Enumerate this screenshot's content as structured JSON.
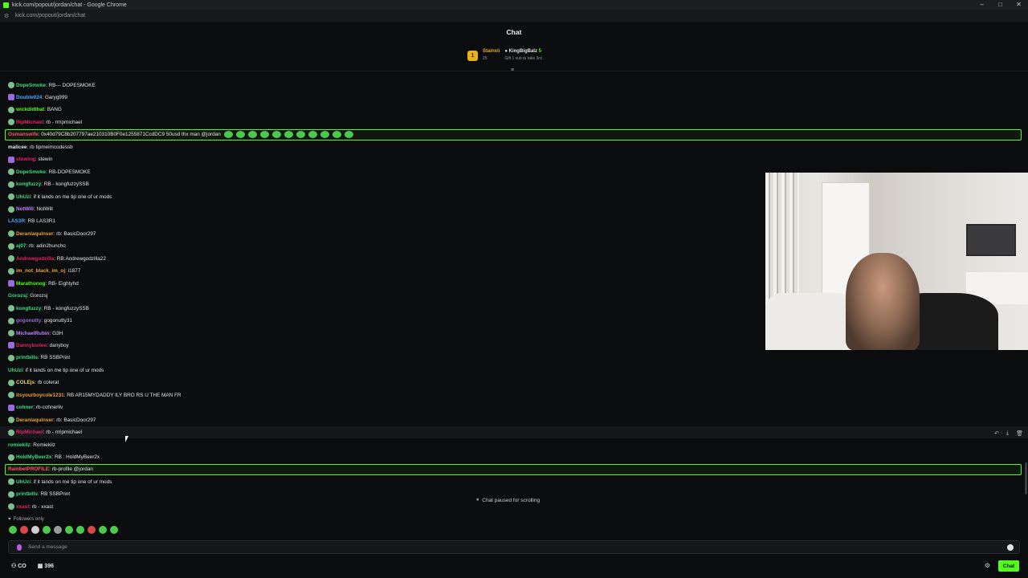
{
  "window": {
    "title": "kick.com/popout/jordan/chat - Google Chrome",
    "url": "kick.com/popout/jordan/chat",
    "controls": [
      "–",
      "□",
      "✕"
    ]
  },
  "header": {
    "title": "Chat"
  },
  "leaderboard": {
    "first": {
      "rank": "1",
      "name": "Stainxii",
      "count": "25"
    },
    "second": {
      "name": "KingBigBalz",
      "count": "5",
      "note": "Gift 1 sub to take 3rd"
    }
  },
  "messages": [
    {
      "user": "DopeSmoke",
      "color": "#3ddc84",
      "text": ": RB--- DOPESMOKE"
    },
    {
      "user": "Double024",
      "color": "#4aa8ff",
      "text": ": Garyg999"
    },
    {
      "user": "wickdidthat",
      "color": "#53fc18",
      "text": ": BANG"
    },
    {
      "user": "RipMichael",
      "color": "#e0245e",
      "text": ": rb - rrripmichael"
    },
    {
      "user": "Osmanswife",
      "color": "#ff4f6d",
      "text": ": 0x40d79C8b207797ae210310B0F0e1255871CcdDC9 50usd thx man @jordan",
      "highlight": true
    },
    {
      "user": "malicee",
      "color": "#e6e6e6",
      "text": ": rb tipmeimcodessb"
    },
    {
      "user": "stewing",
      "color": "#e0245e",
      "text": ": stewin"
    },
    {
      "user": "DopeSmoke",
      "color": "#3ddc84",
      "text": ": RB-DOPESMOKE"
    },
    {
      "user": "kongfuzzy",
      "color": "#3ddc84",
      "text": ": RB - kongfuzzySSB"
    },
    {
      "user": "UhUzi",
      "color": "#3ddc84",
      "text": ": if it lands on me tip one of ur mods"
    },
    {
      "user": "NotWill",
      "color": "#c080ff",
      "text": ": NotWill"
    },
    {
      "user": "LAS3R",
      "color": "#4aa8ff",
      "text": ": RB LAS3R1"
    },
    {
      "user": "Deranlaquinser",
      "color": "#e9a23b",
      "text": ": rb: BasicDoor297"
    },
    {
      "user": "aj07",
      "color": "#3ddc84",
      "text": ": rb: adin2huncho"
    },
    {
      "user": "Andrewgodzilla",
      "color": "#e0245e",
      "text": ": RB:Andrewgodzilla22"
    },
    {
      "user": "im_not_black_im_oj",
      "color": "#e9a23b",
      "text": ": i1877"
    },
    {
      "user": "Marathonog",
      "color": "#53fc18",
      "text": ": RB- Eightyhd"
    },
    {
      "user": "Gorozsj",
      "color": "#3ddc84",
      "text": ": Gorozsj"
    },
    {
      "user": "kongfuzzy",
      "color": "#3ddc84",
      "text": ": RB - kongfuzzySSB"
    },
    {
      "user": "gogonutty",
      "color": "#9a6ad8",
      "text": ": gogonutty31"
    },
    {
      "user": "MichaelRubin",
      "color": "#c080ff",
      "text": ": G3H"
    },
    {
      "user": "Dannyboiiee",
      "color": "#e0245e",
      "text": ": danyboy"
    },
    {
      "user": "printbills",
      "color": "#3ddc84",
      "text": ": RB SSBPrint"
    },
    {
      "user": "UhUzi",
      "color": "#3ddc84",
      "text": ": if it lands on me tip one of ur mods"
    },
    {
      "user": "COLEjs",
      "color": "#f0d36a",
      "text": ": rb colerat"
    },
    {
      "user": "itsyourboycole1231",
      "color": "#e9a23b",
      "text": ": RB AR15MYDADDY ILY BRO RS U THE MAN FR"
    },
    {
      "user": "cohner",
      "color": "#3ddc84",
      "text": ": rb-cohnerliv"
    },
    {
      "user": "Deranlaquinser",
      "color": "#e9a23b",
      "text": ": rb: BasicDoor297"
    },
    {
      "user": "RipMichael",
      "color": "#e0245e",
      "text": ": rb - rrripmichael",
      "hovered": true
    },
    {
      "user": "romiekilz",
      "color": "#3ddc84",
      "text": ": Romiekilz"
    },
    {
      "user": "HoldMyBeer2x",
      "color": "#3ddc84",
      "text": ": RB : HoldMyBeer2x"
    },
    {
      "user": "RainbetPROFILE",
      "color": "#ff4f6d",
      "text": ": rb-profile @jordan",
      "highlight": true
    },
    {
      "user": "UhUzi",
      "color": "#3ddc84",
      "text": ": if it lands on me tip one of ur mods"
    },
    {
      "user": "printbills",
      "color": "#3ddc84",
      "text": ": RB SSBPrint"
    },
    {
      "user": "xxast",
      "color": "#e0245e",
      "text": ": rb - xxast"
    }
  ],
  "chat_status": {
    "paused": "Chat paused for scrolling",
    "mode": "Followers only"
  },
  "input": {
    "placeholder": "Send a message"
  },
  "footer": {
    "points": "CO",
    "viewers": "396",
    "chat_button": "Chat"
  },
  "colors": {
    "accent": "#53fc18",
    "background": "#0b0c0e"
  }
}
